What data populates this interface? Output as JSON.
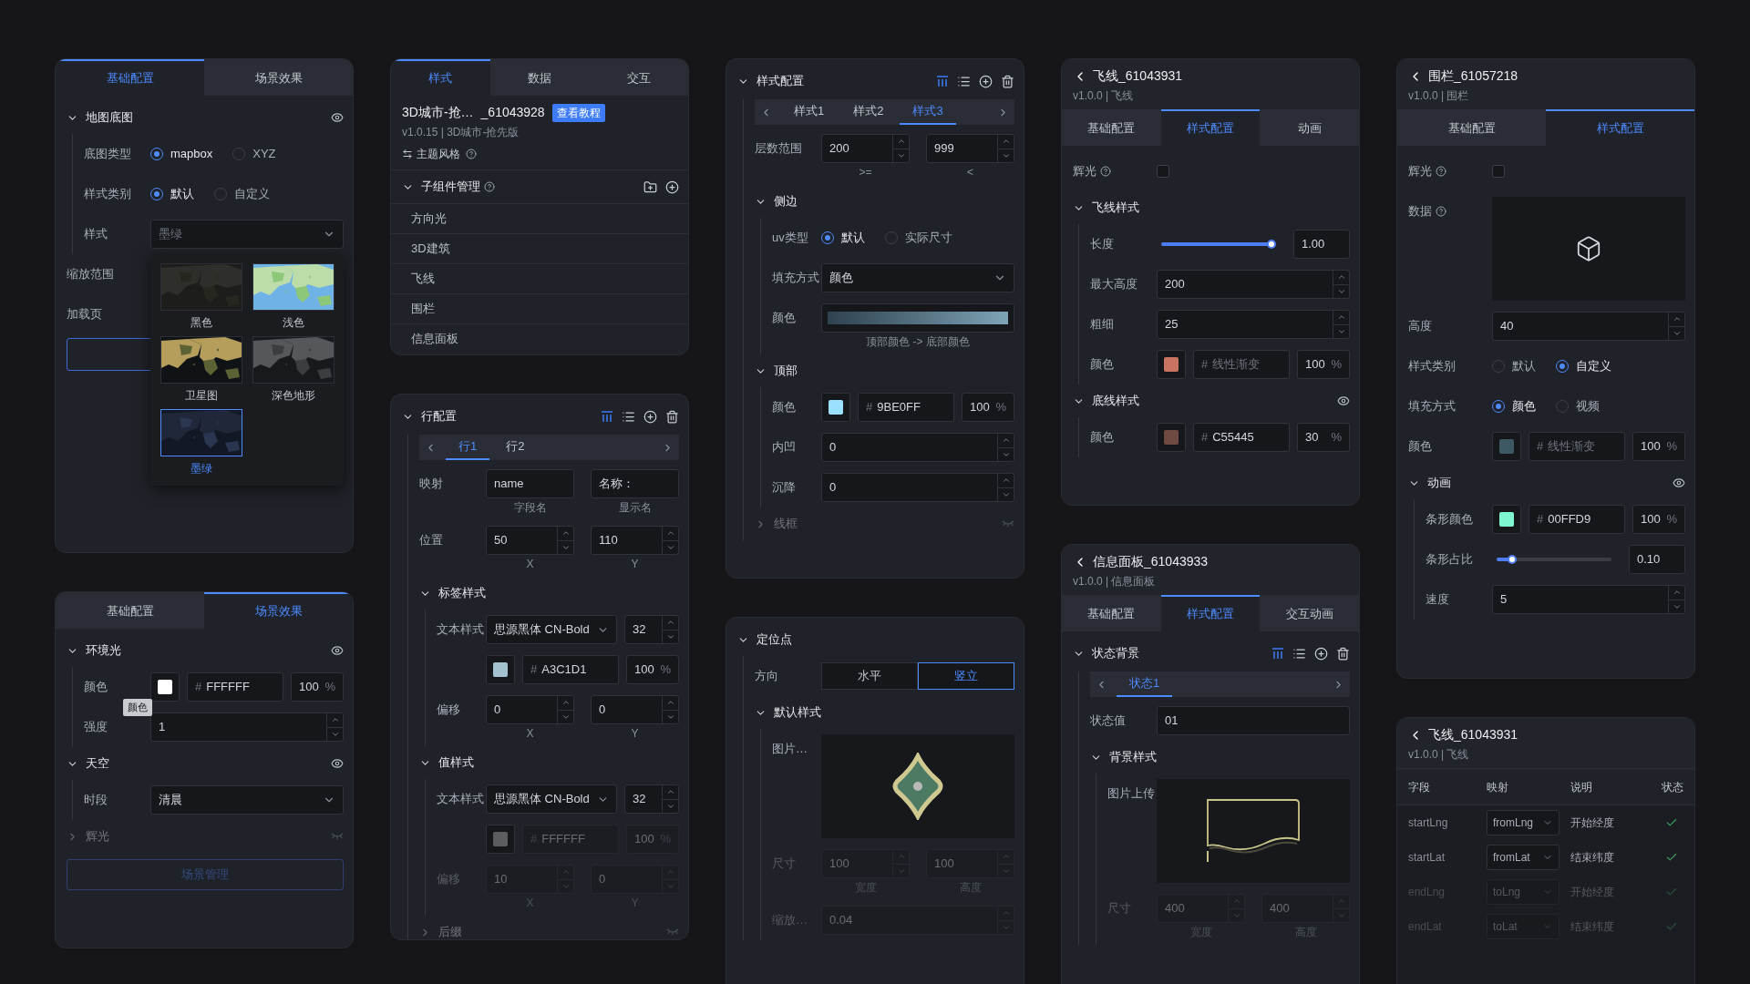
{
  "columns": [
    {
      "panels": [
        {
          "tabs": [
            {
              "label": "基础配置",
              "selected": true
            },
            {
              "label": "场景效果",
              "selected": false
            }
          ],
          "rows": [
            {
              "kind": "section",
              "label": "地图底图",
              "expanded": true,
              "visible": true,
              "children": [
                {
                  "kind": "radio",
                  "label": "底图类型",
                  "options": [
                    {
                      "label": "mapbox",
                      "selected": true
                    },
                    {
                      "label": "XYZ",
                      "selected": false
                    }
                  ]
                },
                {
                  "kind": "radio",
                  "label": "样式类别",
                  "options": [
                    {
                      "label": "默认",
                      "selected": true
                    },
                    {
                      "label": "自定义",
                      "selected": false
                    }
                  ]
                },
                {
                  "kind": "select",
                  "label": "样式",
                  "value": "墨绿",
                  "open": true,
                  "menu": [
                    {
                      "label": "黑色",
                      "selected": false
                    },
                    {
                      "label": "浅色",
                      "selected": false
                    },
                    {
                      "label": "卫星图",
                      "selected": false
                    },
                    {
                      "label": "深色地形",
                      "selected": false
                    },
                    {
                      "label": "墨绿",
                      "selected": true
                    }
                  ]
                }
              ]
            },
            {
              "kind": "label_only",
              "label": "缩放范围"
            },
            {
              "kind": "label_only",
              "label": "加载页"
            },
            {
              "kind": "outline_button"
            }
          ]
        },
        {
          "tabs": [
            {
              "label": "基础配置",
              "selected": false
            },
            {
              "label": "场景效果",
              "selected": true
            }
          ],
          "rows": [
            {
              "kind": "section",
              "label": "环境光",
              "expanded": true,
              "visible": true,
              "children": [
                {
                  "kind": "color",
                  "label": "颜色",
                  "color": "#ffffff",
                  "prefix": "#",
                  "value": "FFFFFF",
                  "percent": "100",
                  "unit": "%"
                },
                {
                  "kind": "number",
                  "label": "强度",
                  "value": "1",
                  "tooltip": "颜色"
                }
              ]
            },
            {
              "kind": "section",
              "label": "天空",
              "expanded": true,
              "visible": true,
              "children": [
                {
                  "kind": "select",
                  "label": "时段",
                  "value": "清晨",
                  "open": false
                }
              ]
            },
            {
              "kind": "section",
              "label": "辉光",
              "expanded": false,
              "visible": false,
              "disabled": true
            },
            {
              "kind": "wide_button",
              "label": "场景管理",
              "disabled": true
            }
          ]
        }
      ]
    },
    {
      "panels": [
        {
          "tabs": [
            {
              "label": "样式",
              "selected": true
            },
            {
              "label": "数据",
              "selected": false
            },
            {
              "label": "交互",
              "selected": false
            }
          ],
          "info": {
            "title": "3D城市-抢…",
            "suffix": "_61043928",
            "badge": "查看教程",
            "subtitle": "v1.0.15 | 3D城市-抢先版",
            "theme": "主题风格"
          },
          "rows": [
            {
              "kind": "section",
              "label": "子组件管理",
              "help": true,
              "expanded": true,
              "folder_tools": true,
              "children": [
                {
                  "kind": "list_item",
                  "label": "方向光"
                },
                {
                  "kind": "list_item",
                  "label": "3D建筑"
                },
                {
                  "kind": "list_item",
                  "label": "飞线"
                },
                {
                  "kind": "list_item",
                  "label": "围栏"
                },
                {
                  "kind": "list_item",
                  "label": "信息面板"
                }
              ]
            }
          ]
        },
        {
          "rows": [
            {
              "kind": "section",
              "label": "行配置",
              "expanded": true,
              "row_tools": true,
              "children": [
                {
                  "kind": "tabs",
                  "items": [
                    {
                      "label": "行1",
                      "selected": true
                    },
                    {
                      "label": "行2",
                      "selected": false
                    }
                  ]
                },
                {
                  "kind": "pair",
                  "label": "映射",
                  "inputs": [
                    {
                      "value": "name",
                      "caption": "字段名",
                      "spinner": false
                    },
                    {
                      "value": "名称：",
                      "caption": "显示名",
                      "spinner": false
                    }
                  ]
                },
                {
                  "kind": "pair",
                  "label": "位置",
                  "inputs": [
                    {
                      "value": "50",
                      "caption": "X",
                      "spinner": true
                    },
                    {
                      "value": "110",
                      "caption": "Y",
                      "spinner": true
                    }
                  ]
                },
                {
                  "kind": "section",
                  "label": "标签样式",
                  "expanded": true,
                  "children": [
                    {
                      "kind": "font",
                      "label": "文本样式",
                      "value": "思源黑体 CN-Bold",
                      "size": "32"
                    },
                    {
                      "kind": "color",
                      "color": "#a3c1d1",
                      "prefix": "#",
                      "value": "A3C1D1",
                      "percent": "100",
                      "unit": "%"
                    },
                    {
                      "kind": "pair",
                      "label": "偏移",
                      "inputs": [
                        {
                          "value": "0",
                          "caption": "X",
                          "spinner": true
                        },
                        {
                          "value": "0",
                          "caption": "Y",
                          "spinner": true
                        }
                      ]
                    }
                  ]
                },
                {
                  "kind": "section",
                  "label": "值样式",
                  "expanded": true,
                  "children": [
                    {
                      "kind": "font",
                      "label": "文本样式",
                      "value": "思源黑体 CN-Bold",
                      "size": "32"
                    },
                    {
                      "kind": "color",
                      "color": "#5c5d60",
                      "prefix": "#",
                      "value": "FFFFFF",
                      "percent": "100",
                      "unit": "%",
                      "disabled": true
                    },
                    {
                      "kind": "pair",
                      "label": "偏移",
                      "inputs": [
                        {
                          "value": "10",
                          "caption": "X",
                          "spinner": true
                        },
                        {
                          "value": "0",
                          "caption": "Y",
                          "spinner": true
                        }
                      ],
                      "disabled": true
                    }
                  ]
                },
                {
                  "kind": "section",
                  "label": "后缀",
                  "expanded": false,
                  "visible": false,
                  "disabled": true
                }
              ]
            }
          ]
        }
      ]
    },
    {
      "panels": [
        {
          "rows": [
            {
              "kind": "section",
              "label": "样式配置",
              "expanded": true,
              "row_tools": true,
              "children": [
                {
                  "kind": "tabs",
                  "items": [
                    {
                      "label": "样式1",
                      "selected": false
                    },
                    {
                      "label": "样式2",
                      "selected": false
                    },
                    {
                      "label": "样式3",
                      "selected": true
                    }
                  ]
                },
                {
                  "kind": "pair",
                  "label": "层数范围",
                  "inputs": [
                    {
                      "value": "200",
                      "caption": ">=",
                      "spinner": true
                    },
                    {
                      "value": "999",
                      "caption": "<",
                      "spinner": true
                    }
                  ]
                },
                {
                  "kind": "section",
                  "label": "侧边",
                  "expanded": true,
                  "children": [
                    {
                      "kind": "radio",
                      "label": "uv类型",
                      "options": [
                        {
                          "label": "默认",
                          "selected": true
                        },
                        {
                          "label": "实际尺寸",
                          "selected": false
                        }
                      ]
                    },
                    {
                      "kind": "select",
                      "label": "填充方式",
                      "value": "颜色",
                      "open": false
                    },
                    {
                      "kind": "gradient",
                      "label": "颜色",
                      "caption": "顶部颜色 -> 底部颜色"
                    }
                  ]
                },
                {
                  "kind": "section",
                  "label": "顶部",
                  "expanded": true,
                  "children": [
                    {
                      "kind": "color",
                      "label": "颜色",
                      "color": "#9be0ff",
                      "prefix": "#",
                      "value": "9BE0FF",
                      "percent": "100",
                      "unit": "%"
                    },
                    {
                      "kind": "number",
                      "label": "内凹",
                      "value": "0"
                    },
                    {
                      "kind": "number",
                      "label": "沉降",
                      "value": "0"
                    }
                  ]
                },
                {
                  "kind": "section",
                  "label": "线框",
                  "expanded": false,
                  "visible": false,
                  "disabled": true
                }
              ]
            }
          ]
        },
        {
          "rows": [
            {
              "kind": "section",
              "label": "定位点",
              "expanded": true,
              "children": [
                {
                  "kind": "segmented",
                  "label": "方向",
                  "options": [
                    {
                      "label": "水平",
                      "selected": false
                    },
                    {
                      "label": "竖立",
                      "selected": true
                    }
                  ]
                },
                {
                  "kind": "section",
                  "label": "默认样式",
                  "expanded": true,
                  "children": [
                    {
                      "kind": "marker_image",
                      "label": "图片…"
                    },
                    {
                      "kind": "pair",
                      "label": "尺寸",
                      "inputs": [
                        {
                          "value": "100",
                          "caption": "宽度",
                          "spinner": true
                        },
                        {
                          "value": "100",
                          "caption": "高度",
                          "spinner": true
                        }
                      ],
                      "disabled": true
                    },
                    {
                      "kind": "number",
                      "label": "缩放…",
                      "value": "0.04",
                      "disabled": true
                    }
                  ]
                }
              ]
            }
          ]
        }
      ]
    },
    {
      "panels": [
        {
          "header": {
            "title": "飞线_61043931",
            "subtitle": "v1.0.0 | 飞线"
          },
          "tabs": [
            {
              "label": "基础配置",
              "selected": false
            },
            {
              "label": "样式配置",
              "selected": true
            },
            {
              "label": "动画",
              "selected": false
            }
          ],
          "rows": [
            {
              "kind": "checkbox",
              "label": "辉光",
              "help": true,
              "checked": false
            },
            {
              "kind": "section",
              "label": "飞线样式",
              "expanded": true,
              "children": [
                {
                  "kind": "slider",
                  "label": "长度",
                  "level": 1,
                  "reading": "1.00"
                },
                {
                  "kind": "number",
                  "label": "最大高度",
                  "value": "200"
                },
                {
                  "kind": "number",
                  "label": "粗细",
                  "value": "25"
                },
                {
                  "kind": "color",
                  "label": "颜色",
                  "color": "#c87461",
                  "prefix": "#",
                  "placeholder": "线性渐变",
                  "percent": "100",
                  "unit": "%"
                }
              ]
            },
            {
              "kind": "section",
              "label": "底线样式",
              "expanded": true,
              "visible": true,
              "children": [
                {
                  "kind": "color",
                  "label": "颜色",
                  "color": "#6e4a42",
                  "prefix": "#",
                  "value": "C55445",
                  "percent": "30",
                  "unit": "%"
                }
              ]
            }
          ]
        },
        {
          "header": {
            "title": "信息面板_61043933",
            "subtitle": "v1.0.0 | 信息面板"
          },
          "tabs": [
            {
              "label": "基础配置",
              "selected": false
            },
            {
              "label": "样式配置",
              "selected": true
            },
            {
              "label": "交互动画",
              "selected": false
            }
          ],
          "rows": [
            {
              "kind": "section",
              "label": "状态背景",
              "expanded": true,
              "row_tools": true,
              "children": [
                {
                  "kind": "tabs",
                  "items": [
                    {
                      "label": "状态1",
                      "selected": true
                    }
                  ]
                },
                {
                  "kind": "text",
                  "label": "状态值",
                  "value": "01"
                },
                {
                  "kind": "section",
                  "label": "背景样式",
                  "expanded": true,
                  "children": [
                    {
                      "kind": "banner_image",
                      "label": "图片上传"
                    },
                    {
                      "kind": "pair",
                      "label": "尺寸",
                      "inputs": [
                        {
                          "value": "400",
                          "caption": "宽度",
                          "spinner": true
                        },
                        {
                          "value": "400",
                          "caption": "高度",
                          "spinner": true
                        }
                      ],
                      "disabled": true
                    }
                  ]
                }
              ]
            }
          ]
        }
      ]
    },
    {
      "panels": [
        {
          "header": {
            "title": "围栏_61057218",
            "subtitle": "v1.0.0 | 围栏"
          },
          "tabs": [
            {
              "label": "基础配置",
              "selected": false
            },
            {
              "label": "样式配置",
              "selected": true
            }
          ],
          "rows": [
            {
              "kind": "checkbox",
              "label": "辉光",
              "help": true,
              "checked": false
            },
            {
              "kind": "cube_image",
              "label": "数据",
              "help": true
            },
            {
              "kind": "number",
              "label": "高度",
              "value": "40"
            },
            {
              "kind": "radio",
              "label": "样式类别",
              "options": [
                {
                  "label": "默认",
                  "selected": false
                },
                {
                  "label": "自定义",
                  "selected": true
                }
              ]
            },
            {
              "kind": "radio",
              "label": "填充方式",
              "options": [
                {
                  "label": "颜色",
                  "selected": true
                },
                {
                  "label": "视频",
                  "selected": false
                }
              ]
            },
            {
              "kind": "color",
              "label": "颜色",
              "color": "#3d5a62",
              "prefix": "#",
              "placeholder": "线性渐变",
              "percent": "100",
              "unit": "%"
            },
            {
              "kind": "section",
              "label": "动画",
              "expanded": true,
              "visible": true,
              "children": [
                {
                  "kind": "color",
                  "label": "条形颜色",
                  "color": "#7ff5d0",
                  "prefix": "#",
                  "value": "00FFD9",
                  "percent": "100",
                  "unit": "%"
                },
                {
                  "kind": "slider",
                  "label": "条形占比",
                  "level": 0.1,
                  "reading": "0.10"
                },
                {
                  "kind": "number",
                  "label": "速度",
                  "value": "5"
                }
              ]
            }
          ]
        },
        {
          "header": {
            "title": "飞线_61043931",
            "subtitle": "v1.0.0 | 飞线"
          },
          "table": {
            "columns": [
              "字段",
              "映射",
              "说明",
              "状态"
            ],
            "rows": [
              {
                "cells": [
                  "startLng",
                  "fromLng",
                  "开始经度"
                ],
                "ok": true,
                "disabled": false
              },
              {
                "cells": [
                  "startLat",
                  "fromLat",
                  "结束纬度"
                ],
                "ok": true,
                "disabled": false
              },
              {
                "cells": [
                  "endLng",
                  "toLng",
                  "开始经度"
                ],
                "ok": true,
                "disabled": true
              },
              {
                "cells": [
                  "endLat",
                  "toLat",
                  "结束纬度"
                ],
                "ok": true,
                "disabled": true
              }
            ]
          }
        }
      ]
    }
  ]
}
